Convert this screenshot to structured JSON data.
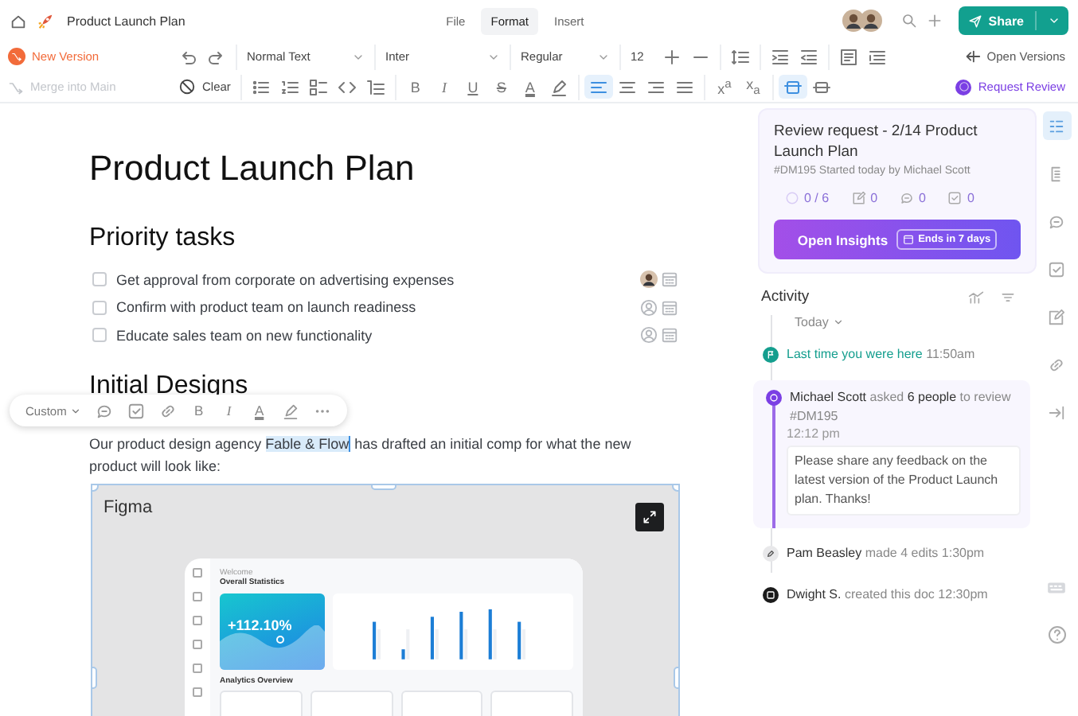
{
  "header": {
    "title": "Product Launch Plan",
    "menu": [
      {
        "label": "File",
        "selected": false
      },
      {
        "label": "Format",
        "selected": true
      },
      {
        "label": "Insert",
        "selected": false
      }
    ],
    "share": "Share"
  },
  "toolbar": {
    "new_version": "New Version",
    "merge": {
      "label": "Merge into Main",
      "disabled": true
    },
    "clear": "Clear",
    "text_style": "Normal Text",
    "font": "Inter",
    "weight": "Regular",
    "size": "12",
    "format_marks": [
      "B",
      "I",
      "U",
      "S",
      "A"
    ],
    "scripts": [
      "x$^{a}$",
      "x$_{a}$"
    ],
    "alignments": [
      {
        "kind": "left",
        "selected": true
      },
      {
        "kind": "center",
        "selected": false
      },
      {
        "kind": "right",
        "selected": false
      },
      {
        "kind": "justify",
        "selected": false
      }
    ],
    "block_modes": [
      {
        "kind": "wrap",
        "selected": true
      },
      {
        "kind": "break",
        "selected": false
      }
    ],
    "open_versions": "Open Versions",
    "request_review": "Request Review"
  },
  "document": {
    "title": "Product Launch Plan",
    "sections": [
      {
        "heading": "Priority tasks",
        "tasks": [
          {
            "text": "Get approval from corporate on advertising expenses",
            "checked": false,
            "assigned": true
          },
          {
            "text": "Confirm with product team on launch readiness",
            "checked": false,
            "assigned": false
          },
          {
            "text": "Educate sales team on new functionality",
            "checked": false,
            "assigned": false
          }
        ]
      },
      {
        "heading": "Initial Designs"
      }
    ],
    "floating_toolbar": {
      "style": "Custom",
      "marks": [
        "B",
        "I",
        "A"
      ]
    },
    "paragraph": {
      "before": "Our product design agency ",
      "selected": "Fable & Flow",
      "after": " has drafted an initial comp for what the new product will look like:"
    },
    "embed": {
      "label": "Figma",
      "preview": {
        "greeting": "Welcome",
        "heading": "Overall Statistics",
        "metric": "+112.10%",
        "section": "Analytics Overview"
      }
    }
  },
  "review": {
    "title": "Review request - 2/14 Product Launch Plan",
    "subtitle": "#DM195 Started today by Michael Scott",
    "stats": [
      {
        "kind": "progress",
        "value": "0 / 6"
      },
      {
        "kind": "edits",
        "value": "0"
      },
      {
        "kind": "comments",
        "value": "0"
      },
      {
        "kind": "tasks",
        "value": "0"
      }
    ],
    "button": "Open Insights",
    "badge": "Ends in 7 days"
  },
  "activity": {
    "title": "Activity",
    "filter": "Today",
    "items": [
      {
        "kind": "visit",
        "text": "Last time you were here",
        "time": "11:50am"
      },
      {
        "kind": "review",
        "text": "**Michael Scott** asked **6 people** to review #DM195",
        "time": "12:12 pm",
        "message": "Please share any feedback on the latest version of the Product Launch plan. Thanks!"
      },
      {
        "kind": "edit",
        "text": "**Pam Beasley** made 4 edits",
        "time": "1:30pm"
      },
      {
        "kind": "create",
        "text": "**Dwight S.** created this doc",
        "time": "12:30pm"
      }
    ]
  },
  "rail": [
    {
      "kind": "outline",
      "selected": true
    },
    {
      "kind": "pages",
      "selected": false
    },
    {
      "kind": "comments",
      "selected": false
    },
    {
      "kind": "tasks",
      "selected": false
    },
    {
      "kind": "edit",
      "selected": false
    },
    {
      "kind": "link",
      "selected": false
    },
    {
      "kind": "collapse",
      "selected": false
    }
  ]
}
